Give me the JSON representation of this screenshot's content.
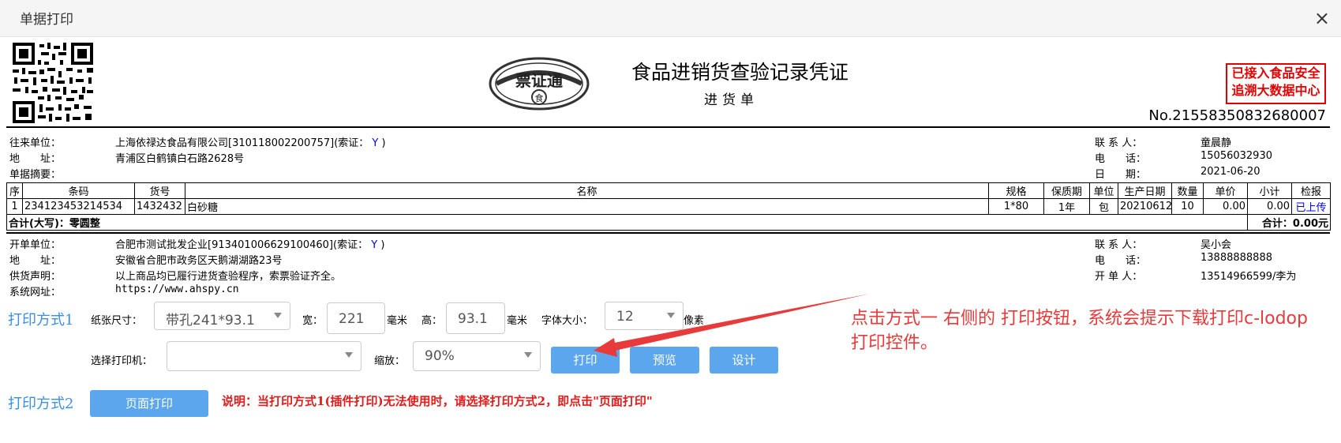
{
  "window": {
    "title": "单据打印",
    "close": "×"
  },
  "doc": {
    "title": "食品进销货查验记录凭证",
    "subtitle": "进货单",
    "number": "No.21558350832680007",
    "stamp_line1": "已接入食品安全",
    "stamp_line2": "追溯大数据中心"
  },
  "header": {
    "partner_label": "往来单位：",
    "partner_value": "上海依禄达食品有限公司[310118002200757](索证：",
    "partner_flag": "Y",
    "partner_close": ")",
    "address_label": "地　　址：",
    "address_value": "青浦区白鹤镇白石路2628号",
    "summary_label": "单据摘要：",
    "contact_label": "联 系 人：",
    "contact_value": "童晨静",
    "phone_label": "电　　话：",
    "phone_value": "15056032930",
    "date_label": "日　　期：",
    "date_value": "2021-06-20"
  },
  "table": {
    "headers": [
      "序",
      "条码",
      "货号",
      "名称",
      "规格",
      "保质期",
      "单位",
      "生产日期",
      "数量",
      "单价",
      "小计",
      "检报"
    ],
    "rows": [
      [
        "1",
        "234123453214534",
        "1432432",
        "白砂糖",
        "1*80",
        "1年",
        "包",
        "20210612",
        "10",
        "0.00",
        "0.00",
        "已上传"
      ]
    ],
    "total_label": "合计(大写)：零圆整",
    "total_right": "合计：0.00元"
  },
  "footer": {
    "issuer_label": "开单单位：",
    "issuer_value": "合肥市测试批发企业[913401006629100460](索证：",
    "issuer_flag": "Y",
    "issuer_close": ")",
    "address_label": "地　　址：",
    "address_value": "安徽省合肥市政务区天鹅湖湖路23号",
    "statement_label": "供货声明：",
    "statement_value": "以上商品均已履行进货查验程序，索票验证齐全。",
    "website_label": "系统网址：",
    "website_value": "https://www.ahspy.cn",
    "contact_label": "联 系 人：",
    "contact_value": "吴小会",
    "phone_label": "电　　话：",
    "phone_value": "13888888888",
    "opener_label": "开 单 人：",
    "opener_value": "13514966599/李为"
  },
  "print1": {
    "mode_label": "打印方式1",
    "paper_label": "纸张尺寸：",
    "paper_value": "带孔241*93.1",
    "width_label": "宽：",
    "width_value": "221",
    "mm1": "毫米",
    "height_label": "高：",
    "height_value": "93.1",
    "mm2": "毫米",
    "font_label": "字体大小：",
    "font_value": "12",
    "px_label": "像素",
    "printer_label": "选择打印机：",
    "printer_value": "",
    "zoom_label": "缩放：",
    "zoom_value": "90%",
    "print_btn": "打印",
    "preview_btn": "预览",
    "design_btn": "设计"
  },
  "print2": {
    "mode_label": "打印方式2",
    "page_print_btn": "页面打印",
    "note": "说明：当打印方式1(插件打印)无法使用时，请选择打印方式2，即点击\"页面打印\""
  },
  "annotation": {
    "line1": "点击方式一 右侧的 打印按钮，系统会提示下载打印c-lodop",
    "line2": "打印控件。"
  },
  "logo": {
    "text": "票证通",
    "sub": "食"
  },
  "colors": {
    "accent": "#5ba6ec",
    "stamp": "#e30000",
    "annotation": "#e83a3a",
    "link": "#0000ee"
  }
}
